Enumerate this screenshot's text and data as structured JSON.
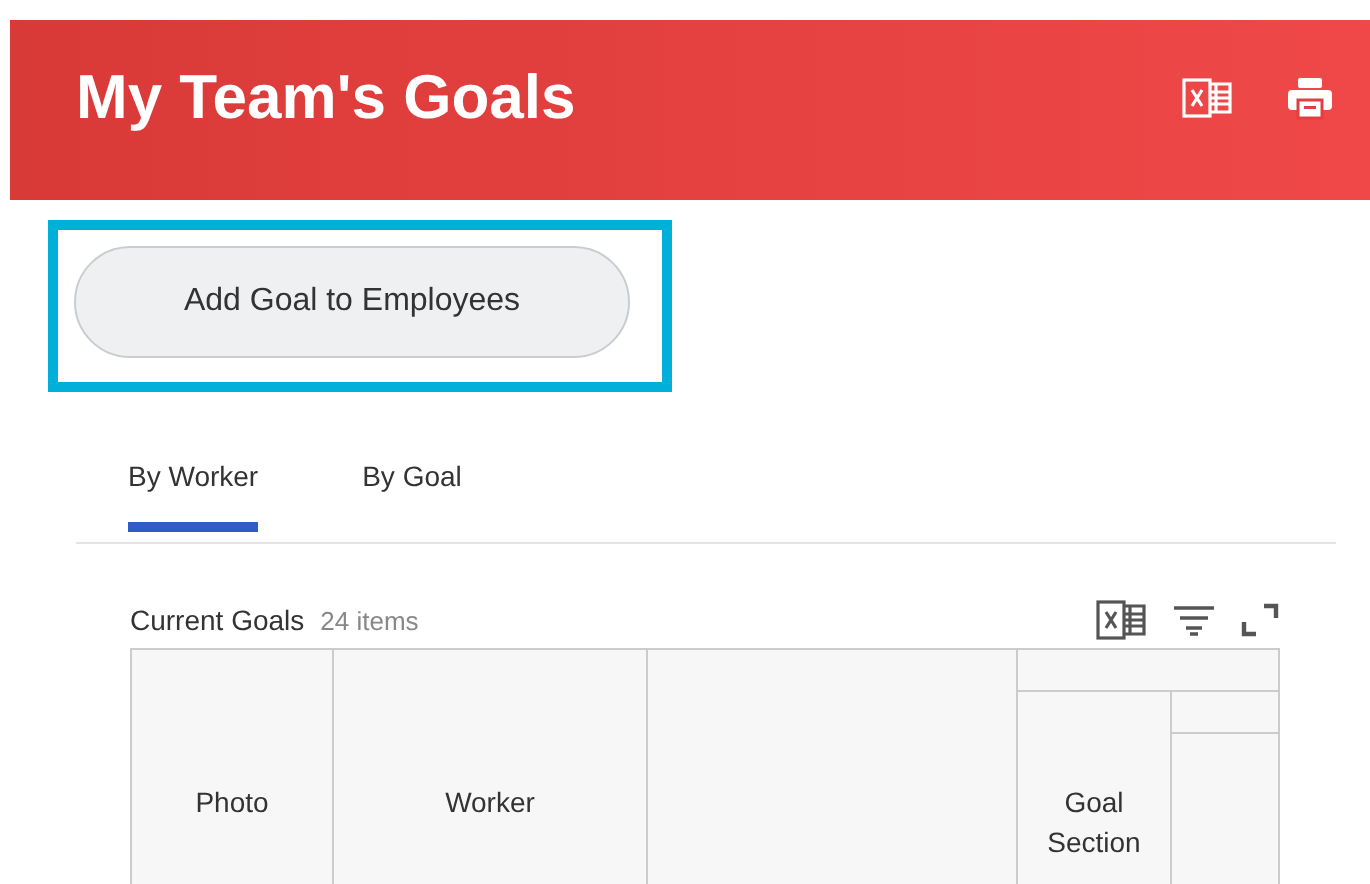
{
  "header": {
    "title": "My Team's Goals"
  },
  "action_button": {
    "label": "Add Goal to Employees",
    "highlighted": true
  },
  "tabs": [
    {
      "label": "By Worker",
      "selected": true
    },
    {
      "label": "By Goal",
      "selected": false
    }
  ],
  "grid": {
    "title": "Current Goals",
    "count": "24 items",
    "columns": [
      {
        "label": "Photo"
      },
      {
        "label": "Worker"
      },
      {
        "label": "Goal Section"
      }
    ]
  }
}
